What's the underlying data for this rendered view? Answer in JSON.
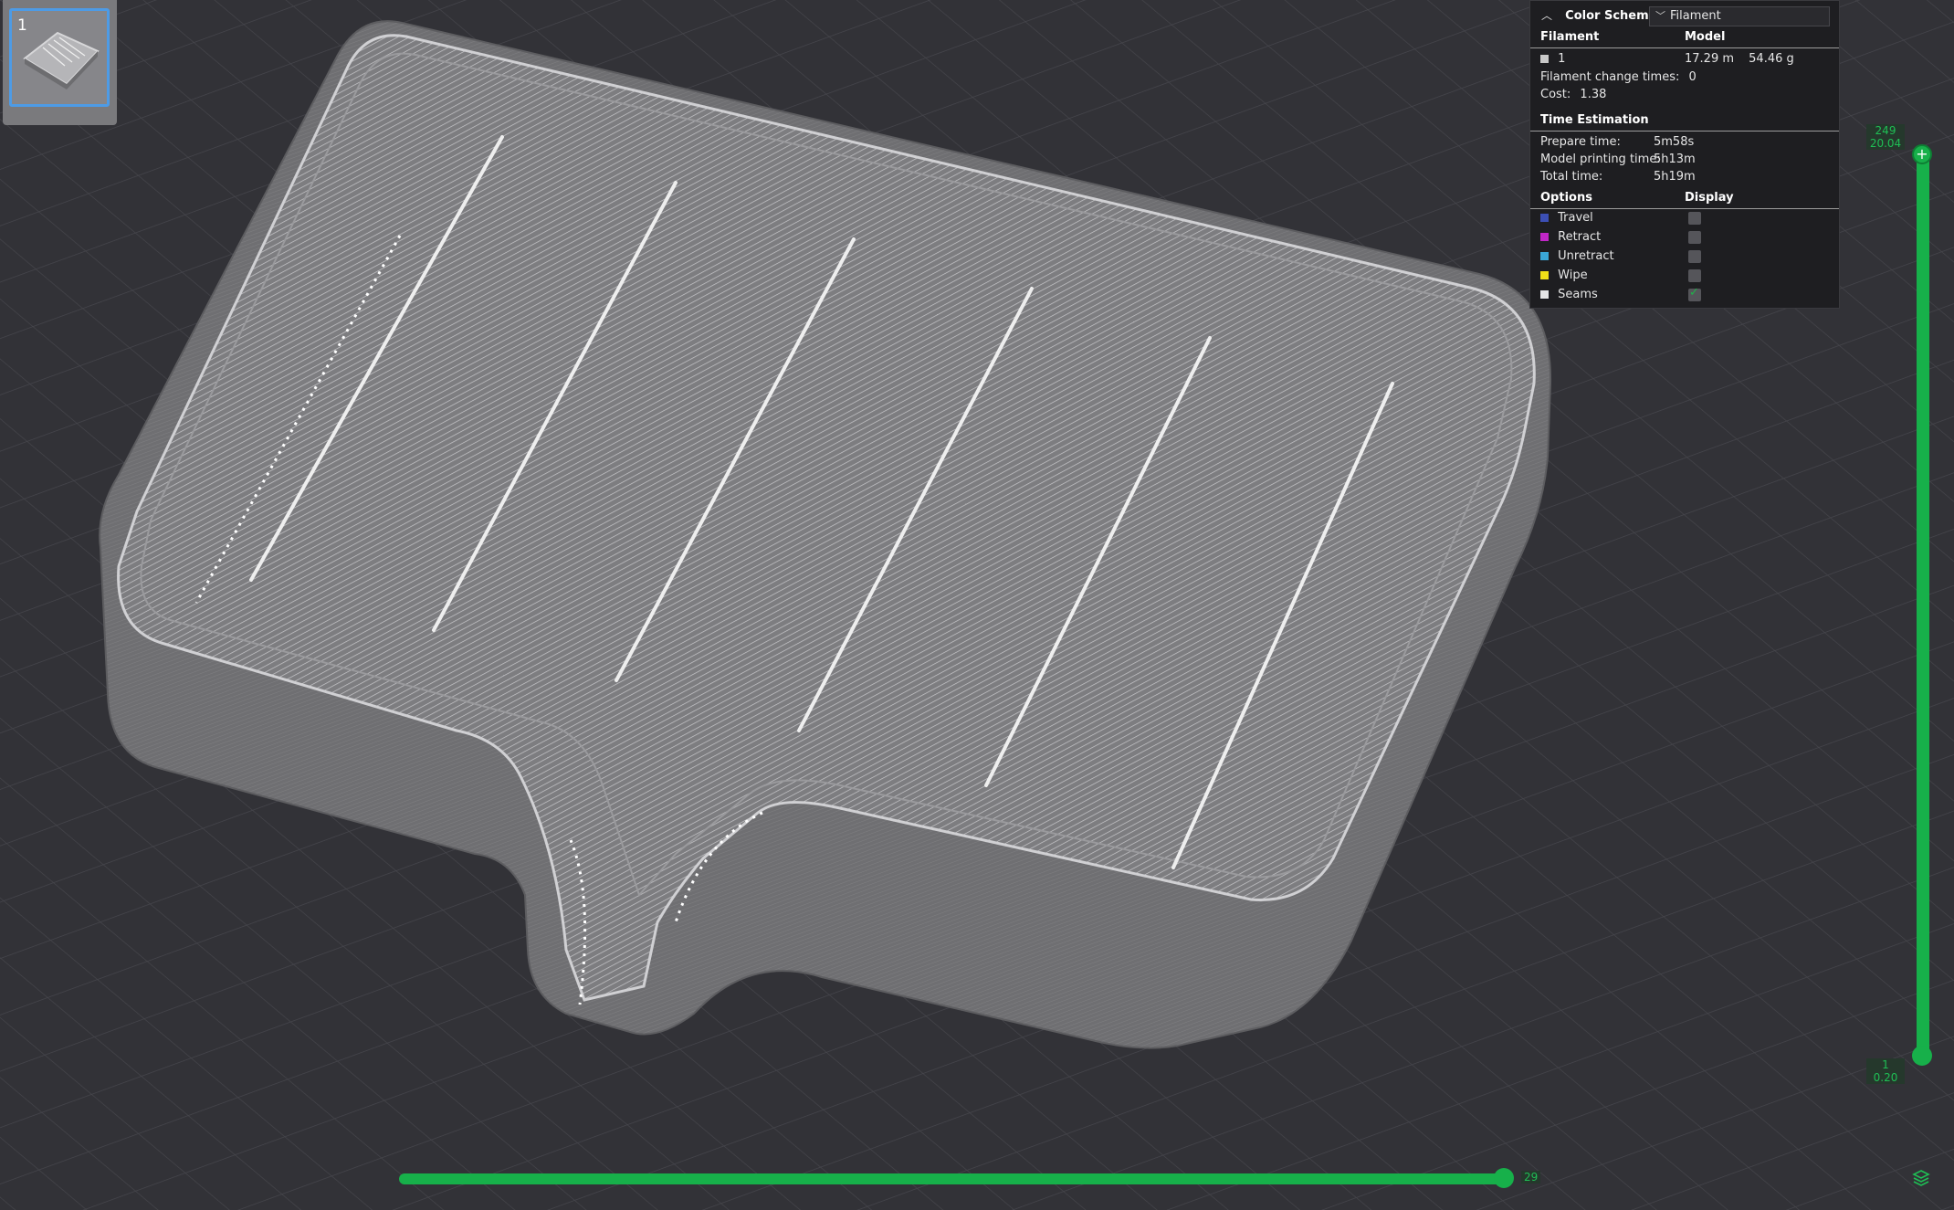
{
  "plate": {
    "number": "1"
  },
  "panel": {
    "color_scheme_label": "Color Scheme",
    "color_scheme_value": "Filament",
    "filament_header": "Filament",
    "model_header": "Model",
    "filament": {
      "id": "1",
      "length": "17.29 m",
      "weight": "54.46 g",
      "color": "#c8c8c8"
    },
    "change_times_label": "Filament change times:",
    "change_times_value": "0",
    "cost_label": "Cost:",
    "cost_value": "1.38",
    "time_header": "Time Estimation",
    "prepare_label": "Prepare time:",
    "prepare_value": "5m58s",
    "model_time_label": "Model printing time:",
    "model_time_value": "5h13m",
    "total_label": "Total time:",
    "total_value": "5h19m",
    "options_header": "Options",
    "display_header": "Display",
    "options": [
      {
        "label": "Travel",
        "color": "#3c4fb4",
        "checked": false
      },
      {
        "label": "Retract",
        "color": "#c026c6",
        "checked": false
      },
      {
        "label": "Unretract",
        "color": "#3aa6d6",
        "checked": false
      },
      {
        "label": "Wipe",
        "color": "#f0e018",
        "checked": false
      },
      {
        "label": "Seams",
        "color": "#e6e6e6",
        "checked": true
      }
    ]
  },
  "vertical_slider": {
    "top_layer": "249",
    "top_height": "20.04",
    "bottom_layer": "1",
    "bottom_height": "0.20"
  },
  "horizontal_slider": {
    "value": "29"
  },
  "accent_color": "#17b04a"
}
